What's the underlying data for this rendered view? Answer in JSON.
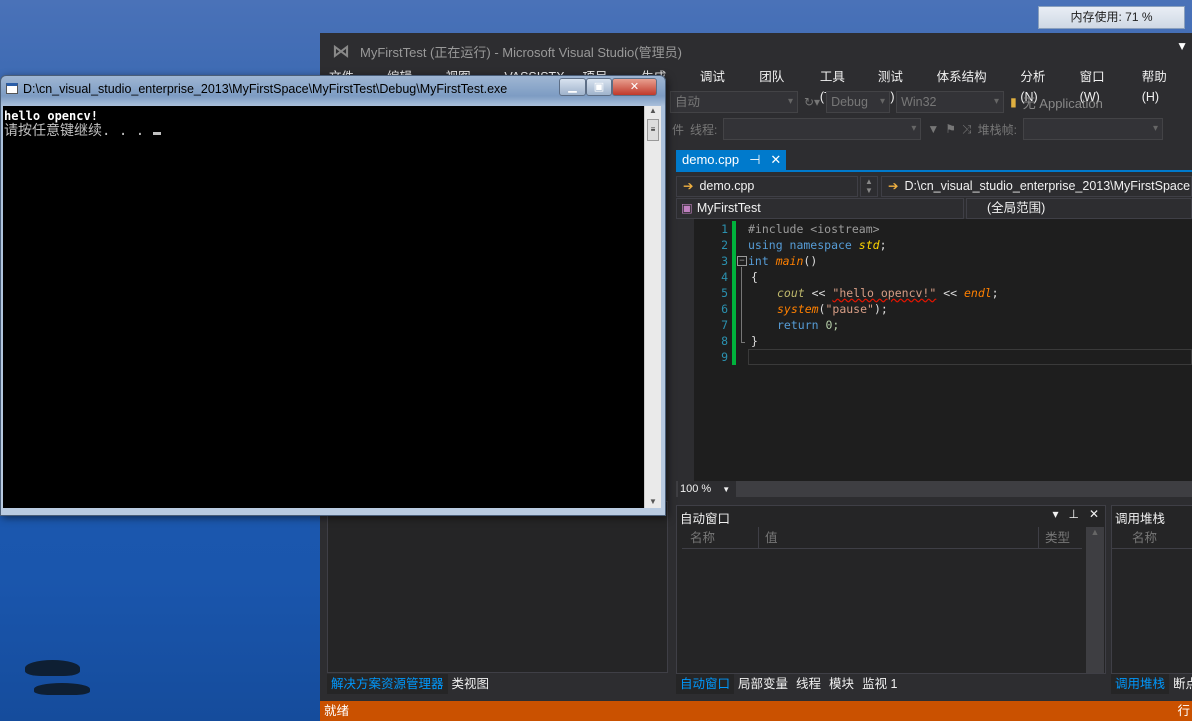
{
  "desktop": {
    "memory_widget": "内存使用: 71 %"
  },
  "vs": {
    "title": "MyFirstTest (正在运行) - Microsoft Visual Studio(管理员)",
    "menu": [
      "文件(F)",
      "编辑(E)",
      "视图(V)",
      "VASSISTX",
      "项目(P)",
      "生成(B)",
      "调试(D)",
      "团队(M)",
      "工具(T)",
      "测试(S)",
      "体系结构(C)",
      "分析(N)",
      "窗口(W)",
      "帮助(H)"
    ],
    "toolbar": {
      "solution_config_auto": "自动",
      "config": "Debug",
      "platform": "Win32",
      "app_insights": "无 Application"
    },
    "debug_toolbar": {
      "process_label": "件",
      "thread_label": "线程:",
      "stack_frame_label": "堆栈帧:"
    },
    "document_tab": {
      "label": "demo.cpp"
    },
    "nav": {
      "file": "demo.cpp",
      "path": "D:\\cn_visual_studio_enterprise_2013\\MyFirstSpace",
      "project": "MyFirstTest",
      "scope": "(全局范围)"
    },
    "code_lines": [
      "1",
      "2",
      "3",
      "4",
      "5",
      "6",
      "7",
      "8",
      "9"
    ],
    "code": {
      "l1_pre": "#include <iostream>",
      "l2_kw": "using namespace ",
      "l2_ty": "std",
      "l2_end": ";",
      "l3_kw": "int ",
      "l3_fn": "main",
      "l3_end": "()",
      "l4": "{",
      "l5_va": "cout",
      "l5_op": " << ",
      "l5_str": "\"hello opencv!\"",
      "l5_op2": " << ",
      "l5_fn": "endl",
      "l5_end": ";",
      "l6_fn": "system",
      "l6_p": "(",
      "l6_str": "\"pause\"",
      "l6_end": ");",
      "l7_kw": "return ",
      "l7_val": "0;",
      "l8": "}"
    },
    "zoom": "100 %",
    "autos": {
      "title": "自动窗口",
      "columns": [
        "名称",
        "值",
        "类型"
      ]
    },
    "call_stack": {
      "title": "调用堆栈",
      "columns": [
        "名称"
      ]
    },
    "left_tabs": [
      "解决方案资源管理器",
      "类视图"
    ],
    "bottom_tabs": [
      "自动窗口",
      "局部变量",
      "线程",
      "模块",
      "监视 1"
    ],
    "right_tabs": [
      "调用堆栈",
      "断点"
    ],
    "status": {
      "text": "就绪",
      "right": "行"
    },
    "colors": {
      "accent": "#007acc",
      "status": "#ca5100",
      "breakpoint_bar": "#00b23c"
    }
  },
  "console": {
    "title": "D:\\cn_visual_studio_enterprise_2013\\MyFirstSpace\\MyFirstTest\\Debug\\MyFirstTest.exe",
    "lines": [
      "hello opencv!",
      "请按任意键继续. . . "
    ]
  }
}
